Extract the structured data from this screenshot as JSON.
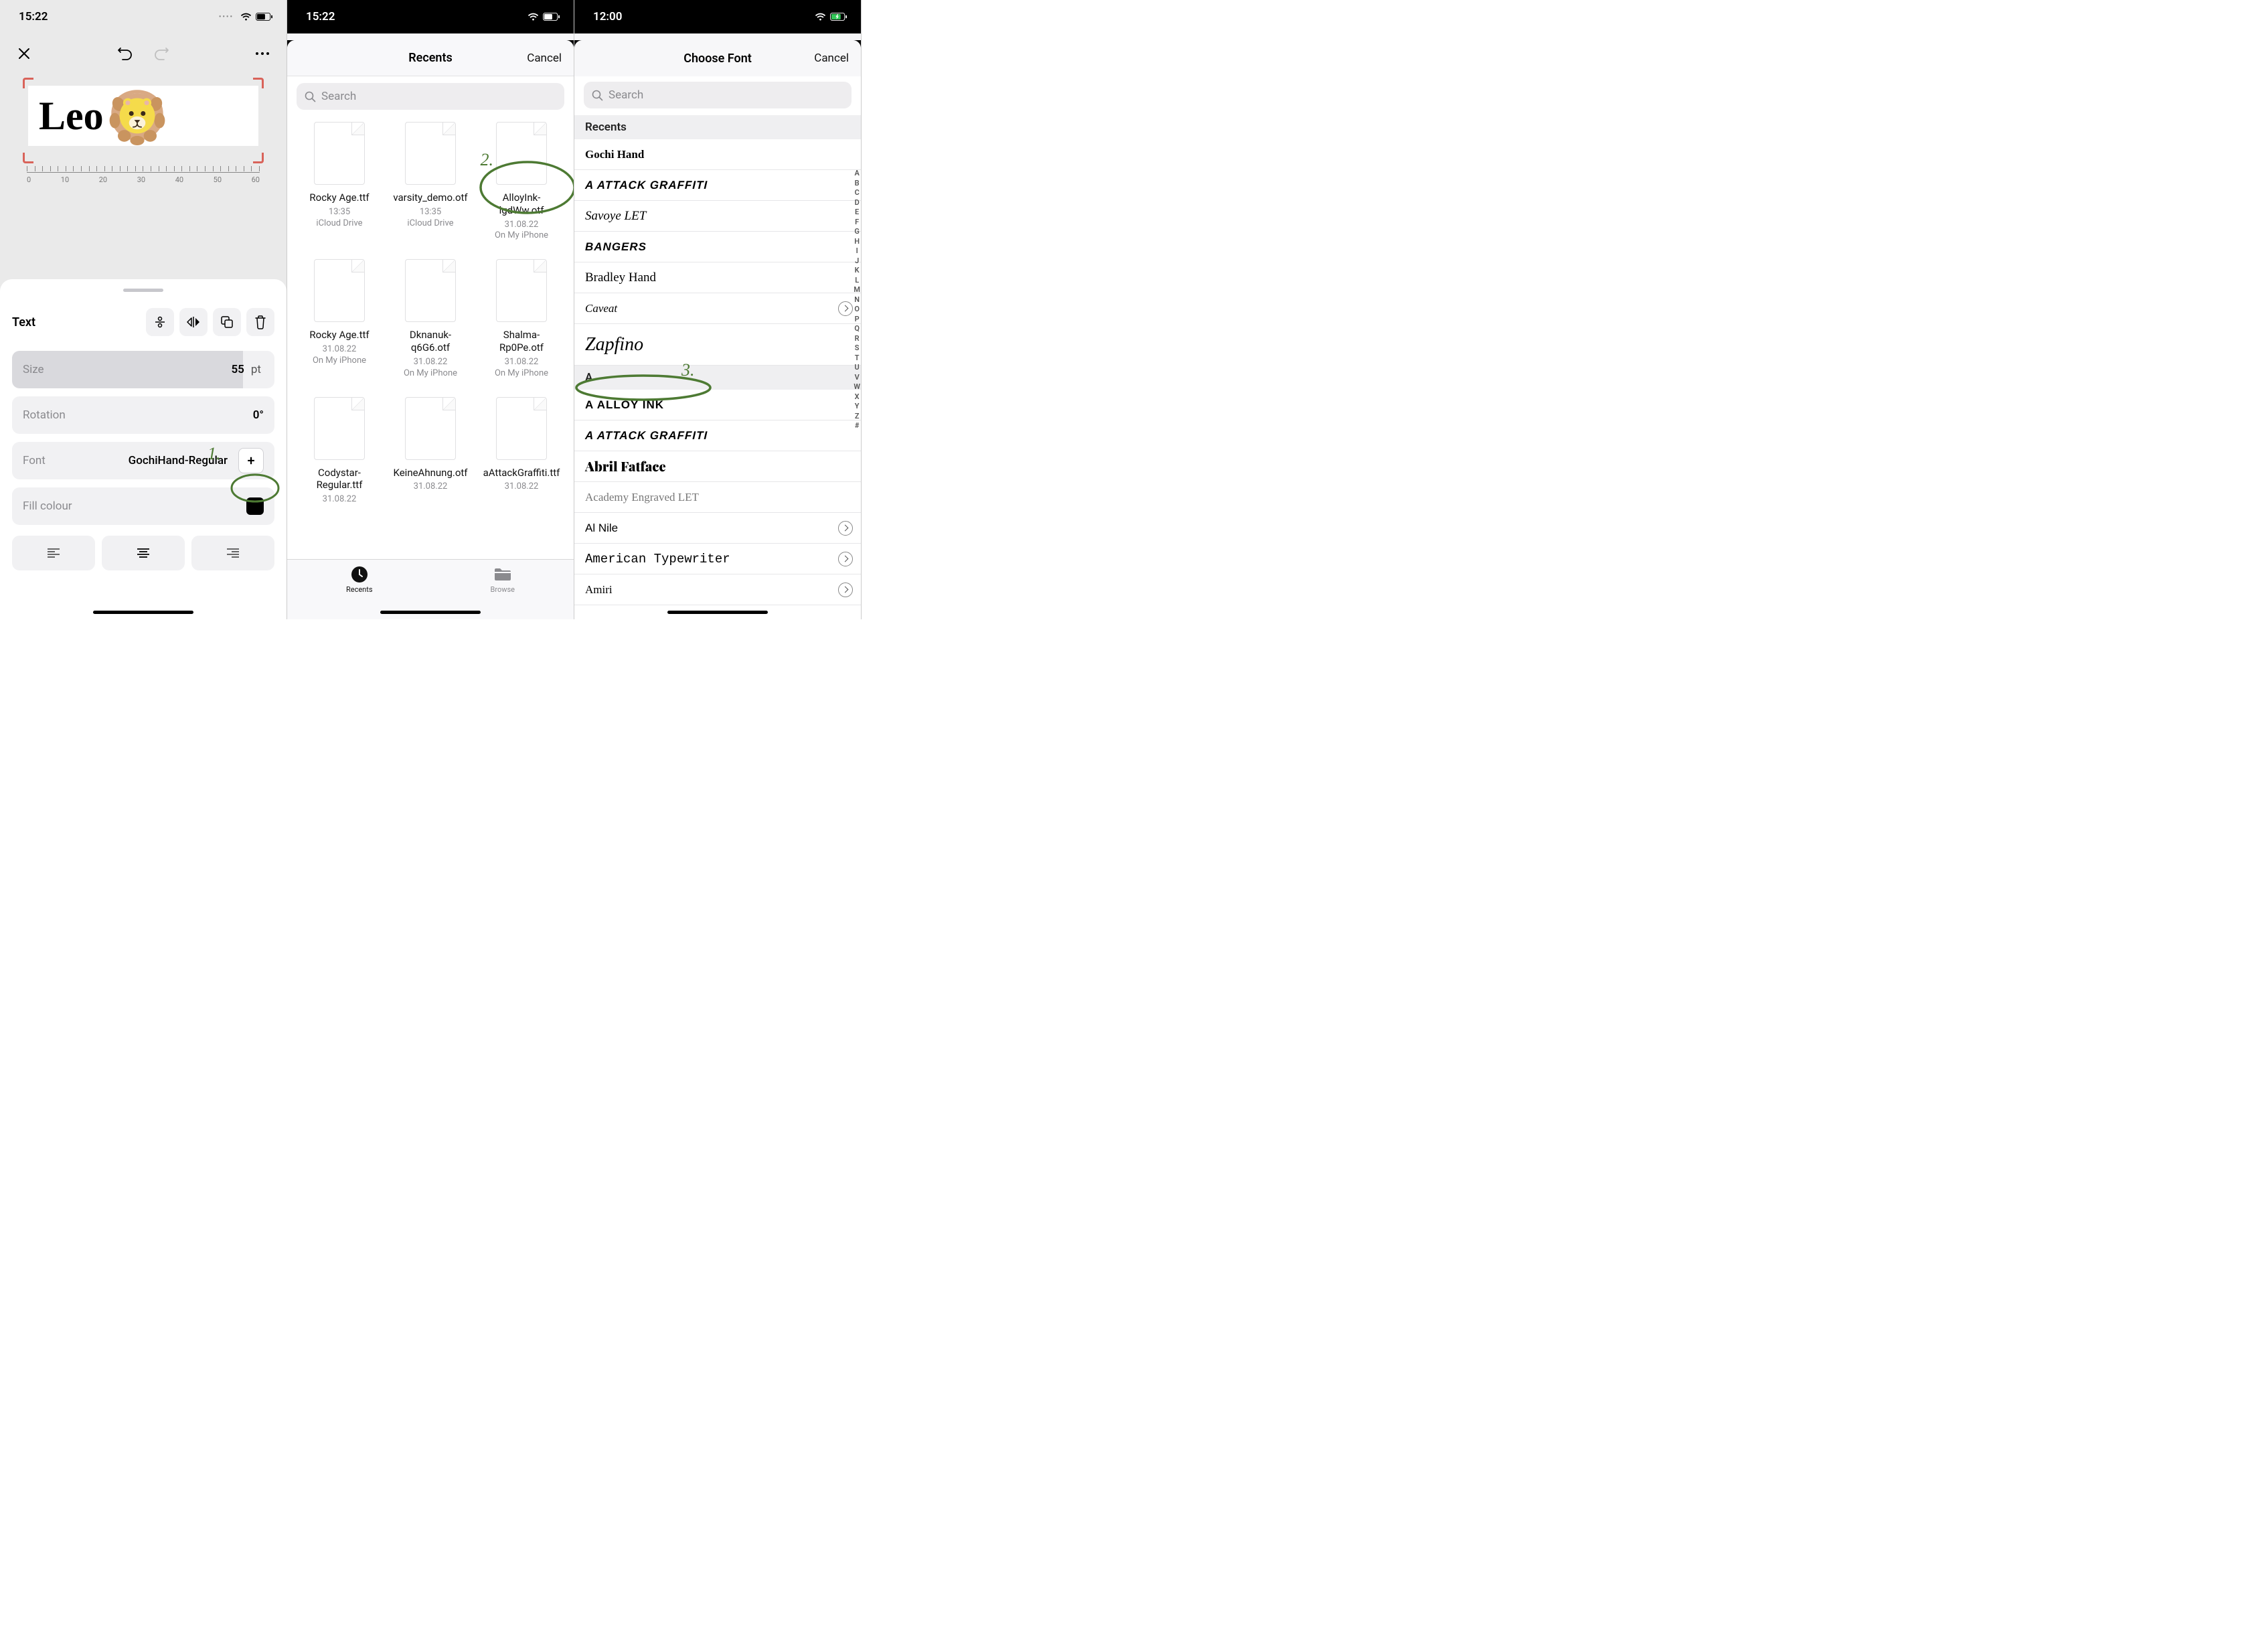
{
  "screen1": {
    "time": "15:22",
    "canvas_text": "Leo",
    "ruler": [
      "0",
      "10",
      "20",
      "30",
      "40",
      "50",
      "60"
    ],
    "sheet": {
      "title": "Text",
      "size_label": "Size",
      "size_value": "55",
      "size_unit": "pt",
      "rotation_label": "Rotation",
      "rotation_value": "0°",
      "font_label": "Font",
      "font_value": "GochiHand-Regular",
      "fill_label": "Fill colour",
      "fill_value": "#000000"
    },
    "annotation": "1."
  },
  "screen2": {
    "time": "15:22",
    "nav_title": "Recents",
    "cancel": "Cancel",
    "search_placeholder": "Search",
    "files": [
      {
        "name": "Rocky Age.ttf",
        "meta1": "13:35",
        "meta2": "iCloud Drive"
      },
      {
        "name": "varsity_demo.otf",
        "meta1": "13:35",
        "meta2": "iCloud Drive"
      },
      {
        "name": "AlloyInk-lgdWw.otf",
        "meta1": "31.08.22",
        "meta2": "On My iPhone"
      },
      {
        "name": "Rocky Age.ttf",
        "meta1": "31.08.22",
        "meta2": "On My iPhone"
      },
      {
        "name": "Dknanuk-q6G6.otf",
        "meta1": "31.08.22",
        "meta2": "On My iPhone"
      },
      {
        "name": "Shalma-Rp0Pe.otf",
        "meta1": "31.08.22",
        "meta2": "On My iPhone"
      },
      {
        "name": "Codystar-Regular.ttf",
        "meta1": "31.08.22",
        "meta2": ""
      },
      {
        "name": "KeineAhnung.otf",
        "meta1": "31.08.22",
        "meta2": ""
      },
      {
        "name": "aAttackGraffiti.ttf",
        "meta1": "31.08.22",
        "meta2": ""
      }
    ],
    "tabs": {
      "recents": "Recents",
      "browse": "Browse"
    },
    "annotation": "2."
  },
  "screen3": {
    "time": "12:00",
    "nav_title": "Choose Font",
    "cancel": "Cancel",
    "search_placeholder": "Search",
    "section_recents": "Recents",
    "recents": [
      {
        "label": "Gochi Hand",
        "style": "f-gochi"
      },
      {
        "label": "A ATTACK GRAFFITI",
        "style": "f-graffiti"
      },
      {
        "label": "Savoye LET",
        "style": "f-savoye"
      },
      {
        "label": "BANGERS",
        "style": "f-bangers"
      },
      {
        "label": "Bradley Hand",
        "style": "f-bradley"
      },
      {
        "label": "Caveat",
        "style": "f-caveat",
        "chevron": true
      },
      {
        "label": "Zapfino",
        "style": "f-zapfino",
        "tall": true
      }
    ],
    "section_a": "A",
    "a_fonts": [
      {
        "label": "A ALLOY INK",
        "style": "f-alloy"
      },
      {
        "label": "A ATTACK GRAFFITI",
        "style": "f-graffiti"
      },
      {
        "label": "Abril Fatface",
        "style": "f-abril"
      },
      {
        "label": "Academy Engraved LET",
        "style": "f-academy"
      },
      {
        "label": "Al Nile",
        "style": "f-alnile",
        "chevron": true
      },
      {
        "label": "American Typewriter",
        "style": "f-typewriter",
        "chevron": true
      },
      {
        "label": "Amiri",
        "style": "f-amiri",
        "chevron": true
      }
    ],
    "index": [
      "A",
      "B",
      "C",
      "D",
      "E",
      "F",
      "G",
      "H",
      "I",
      "J",
      "K",
      "L",
      "M",
      "N",
      "O",
      "P",
      "Q",
      "R",
      "S",
      "T",
      "U",
      "V",
      "W",
      "X",
      "Y",
      "Z",
      "#"
    ],
    "annotation": "3."
  }
}
